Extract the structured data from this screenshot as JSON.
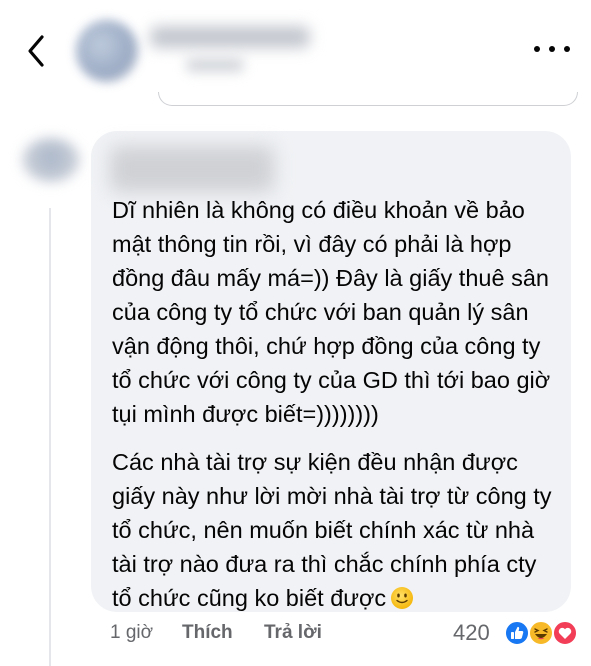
{
  "header": {
    "back_icon": "chevron-left-icon",
    "more_icon": "more-horizontal-icon"
  },
  "comment": {
    "paragraphs": [
      "Dĩ nhiên là không có điều khoản về bảo mật thông tin rồi, vì đây có phải là hợp đồng đâu mấy má=)) Đây là giấy thuê sân của công ty tổ chức với ban quản lý sân vận động thôi, chứ hợp đồng của công ty tổ chức với công ty của GD thì tới bao giờ tụi mình được biết=))))))))",
      "Các nhà tài trợ sự kiện đều nhận được giấy này như lời mời nhà tài trợ từ công ty tổ chức, nên muốn biết chính xác từ nhà tài trợ nào đưa ra thì chắc chính phía cty tổ chức cũng ko biết được"
    ],
    "emoji": "slightly-smiling-face-icon"
  },
  "actions": {
    "time": "1 giờ",
    "like_label": "Thích",
    "reply_label": "Trả lời",
    "reaction_count": "420",
    "reaction_icons": [
      "like-reaction-icon",
      "haha-reaction-icon",
      "love-reaction-icon"
    ]
  },
  "colors": {
    "bubble": "#f0f2f5",
    "secondary_text": "#65676b",
    "like_blue": "#1877f2",
    "haha_yellow": "#f7b928",
    "love_red": "#f33e58"
  }
}
